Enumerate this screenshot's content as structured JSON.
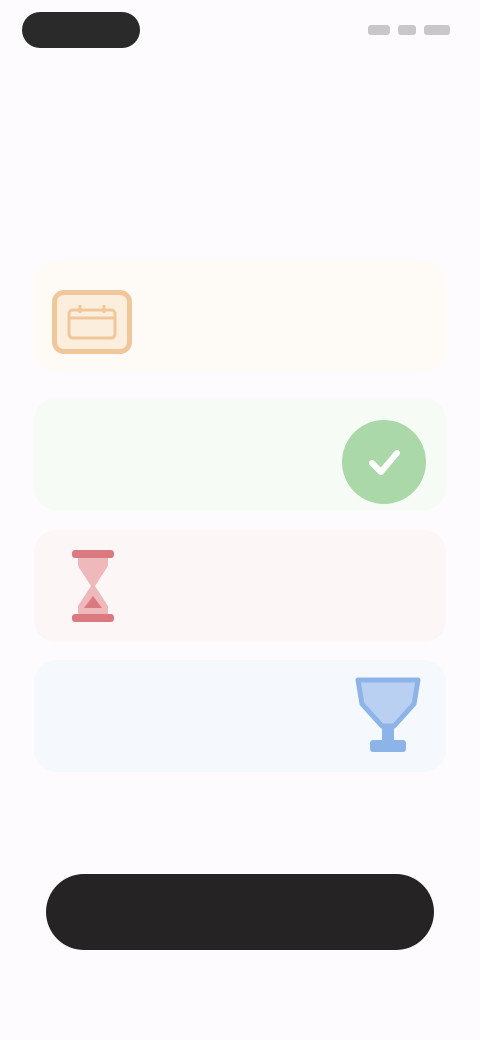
{
  "status_bar": {
    "time": "",
    "icons": [
      "signal-icon",
      "wifi-icon",
      "battery-icon"
    ]
  },
  "title": "",
  "cards": [
    {
      "icon": "calendar-icon",
      "color": "#f0c79a",
      "title": "",
      "subtitle": ""
    },
    {
      "icon": "check-circle-icon",
      "color": "#aad8a8",
      "title": "",
      "subtitle": ""
    },
    {
      "icon": "hourglass-icon",
      "color": "#d97a80",
      "title": "",
      "subtitle": ""
    },
    {
      "icon": "trophy-icon",
      "color": "#8db4e8",
      "title": "",
      "subtitle": ""
    }
  ],
  "footnote": "",
  "cta": {
    "label": "",
    "color": "#262324"
  }
}
